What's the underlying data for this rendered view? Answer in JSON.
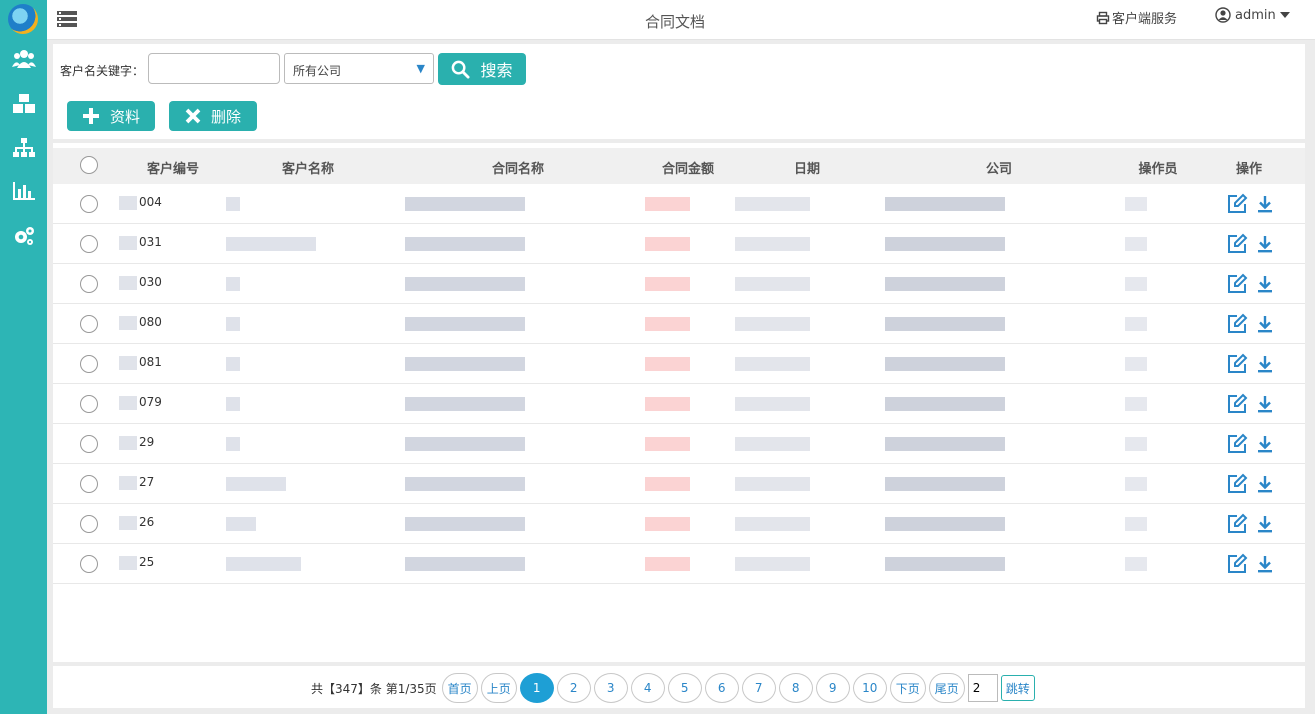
{
  "header": {
    "title": "合同文档",
    "client_service": "客户端服务",
    "user": "admin"
  },
  "search": {
    "label": "客户名关键字：",
    "input_value": "",
    "company_selected": "所有公司",
    "search_label": "搜索"
  },
  "toolbar": {
    "add_label": "资料",
    "delete_label": "删除"
  },
  "table": {
    "columns": [
      "客户编号",
      "客户名称",
      "合同名称",
      "合同金额",
      "日期",
      "公司",
      "操作员",
      "操作"
    ],
    "ids": [
      "004",
      "031",
      "030",
      "080",
      "081",
      "079",
      "29",
      "27",
      "26",
      "25"
    ]
  },
  "pagination": {
    "summary": "共【347】条 第1/35页",
    "first": "首页",
    "prev": "上页",
    "pages": [
      "1",
      "2",
      "3",
      "4",
      "5",
      "6",
      "7",
      "8",
      "9",
      "10"
    ],
    "next": "下页",
    "last": "尾页",
    "jump_value": "2",
    "jump": "跳转"
  },
  "colors": {
    "accent": "#2ab0ae",
    "sidebar": "#2db5b5",
    "active_page": "#1e9fd5",
    "action_icon": "#2a86c8"
  },
  "icons": [
    "menu-icon",
    "users-icon",
    "cubes-icon",
    "sitemap-icon",
    "bar-chart-icon",
    "gears-icon",
    "printer-icon",
    "user-circle-icon",
    "caret-down-icon",
    "search-icon",
    "plus-icon",
    "times-icon",
    "edit-icon",
    "download-icon"
  ]
}
